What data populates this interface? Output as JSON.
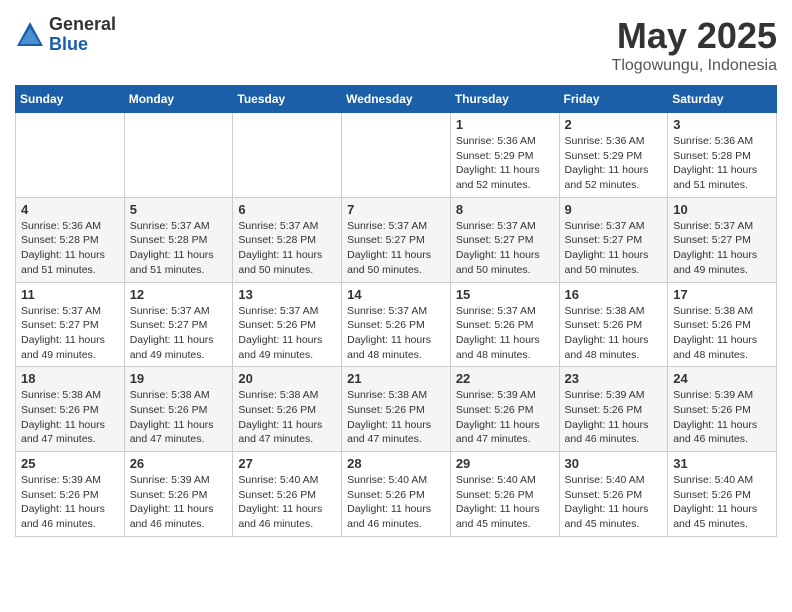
{
  "logo": {
    "general": "General",
    "blue": "Blue"
  },
  "title": {
    "month_year": "May 2025",
    "location": "Tlogowungu, Indonesia"
  },
  "days_of_week": [
    "Sunday",
    "Monday",
    "Tuesday",
    "Wednesday",
    "Thursday",
    "Friday",
    "Saturday"
  ],
  "weeks": [
    [
      {
        "day": "",
        "info": ""
      },
      {
        "day": "",
        "info": ""
      },
      {
        "day": "",
        "info": ""
      },
      {
        "day": "",
        "info": ""
      },
      {
        "day": "1",
        "info": "Sunrise: 5:36 AM\nSunset: 5:29 PM\nDaylight: 11 hours and 52 minutes."
      },
      {
        "day": "2",
        "info": "Sunrise: 5:36 AM\nSunset: 5:29 PM\nDaylight: 11 hours and 52 minutes."
      },
      {
        "day": "3",
        "info": "Sunrise: 5:36 AM\nSunset: 5:28 PM\nDaylight: 11 hours and 51 minutes."
      }
    ],
    [
      {
        "day": "4",
        "info": "Sunrise: 5:36 AM\nSunset: 5:28 PM\nDaylight: 11 hours and 51 minutes."
      },
      {
        "day": "5",
        "info": "Sunrise: 5:37 AM\nSunset: 5:28 PM\nDaylight: 11 hours and 51 minutes."
      },
      {
        "day": "6",
        "info": "Sunrise: 5:37 AM\nSunset: 5:28 PM\nDaylight: 11 hours and 50 minutes."
      },
      {
        "day": "7",
        "info": "Sunrise: 5:37 AM\nSunset: 5:27 PM\nDaylight: 11 hours and 50 minutes."
      },
      {
        "day": "8",
        "info": "Sunrise: 5:37 AM\nSunset: 5:27 PM\nDaylight: 11 hours and 50 minutes."
      },
      {
        "day": "9",
        "info": "Sunrise: 5:37 AM\nSunset: 5:27 PM\nDaylight: 11 hours and 50 minutes."
      },
      {
        "day": "10",
        "info": "Sunrise: 5:37 AM\nSunset: 5:27 PM\nDaylight: 11 hours and 49 minutes."
      }
    ],
    [
      {
        "day": "11",
        "info": "Sunrise: 5:37 AM\nSunset: 5:27 PM\nDaylight: 11 hours and 49 minutes."
      },
      {
        "day": "12",
        "info": "Sunrise: 5:37 AM\nSunset: 5:27 PM\nDaylight: 11 hours and 49 minutes."
      },
      {
        "day": "13",
        "info": "Sunrise: 5:37 AM\nSunset: 5:26 PM\nDaylight: 11 hours and 49 minutes."
      },
      {
        "day": "14",
        "info": "Sunrise: 5:37 AM\nSunset: 5:26 PM\nDaylight: 11 hours and 48 minutes."
      },
      {
        "day": "15",
        "info": "Sunrise: 5:37 AM\nSunset: 5:26 PM\nDaylight: 11 hours and 48 minutes."
      },
      {
        "day": "16",
        "info": "Sunrise: 5:38 AM\nSunset: 5:26 PM\nDaylight: 11 hours and 48 minutes."
      },
      {
        "day": "17",
        "info": "Sunrise: 5:38 AM\nSunset: 5:26 PM\nDaylight: 11 hours and 48 minutes."
      }
    ],
    [
      {
        "day": "18",
        "info": "Sunrise: 5:38 AM\nSunset: 5:26 PM\nDaylight: 11 hours and 47 minutes."
      },
      {
        "day": "19",
        "info": "Sunrise: 5:38 AM\nSunset: 5:26 PM\nDaylight: 11 hours and 47 minutes."
      },
      {
        "day": "20",
        "info": "Sunrise: 5:38 AM\nSunset: 5:26 PM\nDaylight: 11 hours and 47 minutes."
      },
      {
        "day": "21",
        "info": "Sunrise: 5:38 AM\nSunset: 5:26 PM\nDaylight: 11 hours and 47 minutes."
      },
      {
        "day": "22",
        "info": "Sunrise: 5:39 AM\nSunset: 5:26 PM\nDaylight: 11 hours and 47 minutes."
      },
      {
        "day": "23",
        "info": "Sunrise: 5:39 AM\nSunset: 5:26 PM\nDaylight: 11 hours and 46 minutes."
      },
      {
        "day": "24",
        "info": "Sunrise: 5:39 AM\nSunset: 5:26 PM\nDaylight: 11 hours and 46 minutes."
      }
    ],
    [
      {
        "day": "25",
        "info": "Sunrise: 5:39 AM\nSunset: 5:26 PM\nDaylight: 11 hours and 46 minutes."
      },
      {
        "day": "26",
        "info": "Sunrise: 5:39 AM\nSunset: 5:26 PM\nDaylight: 11 hours and 46 minutes."
      },
      {
        "day": "27",
        "info": "Sunrise: 5:40 AM\nSunset: 5:26 PM\nDaylight: 11 hours and 46 minutes."
      },
      {
        "day": "28",
        "info": "Sunrise: 5:40 AM\nSunset: 5:26 PM\nDaylight: 11 hours and 46 minutes."
      },
      {
        "day": "29",
        "info": "Sunrise: 5:40 AM\nSunset: 5:26 PM\nDaylight: 11 hours and 45 minutes."
      },
      {
        "day": "30",
        "info": "Sunrise: 5:40 AM\nSunset: 5:26 PM\nDaylight: 11 hours and 45 minutes."
      },
      {
        "day": "31",
        "info": "Sunrise: 5:40 AM\nSunset: 5:26 PM\nDaylight: 11 hours and 45 minutes."
      }
    ]
  ]
}
